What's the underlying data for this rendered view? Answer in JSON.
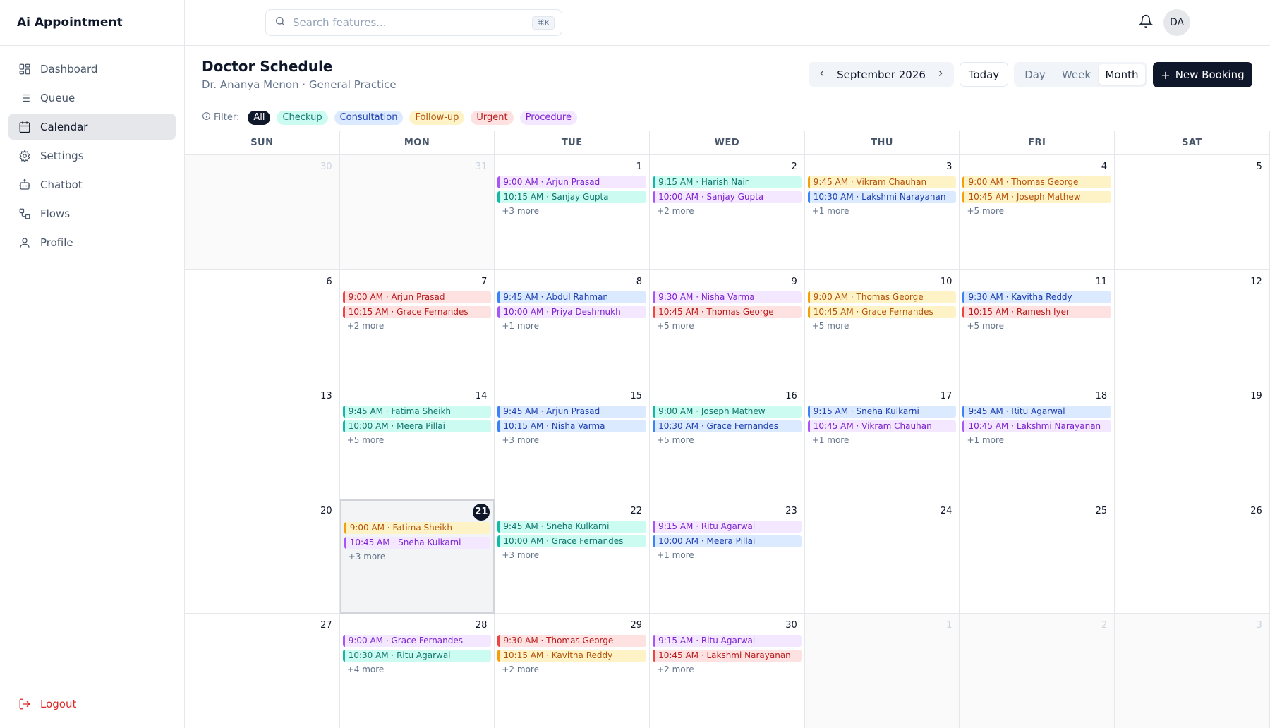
{
  "app": {
    "title": "Ai Appointment"
  },
  "sidebar": {
    "items": [
      {
        "label": "Dashboard",
        "icon": "dashboard-icon",
        "active": false
      },
      {
        "label": "Queue",
        "icon": "list-icon",
        "active": false
      },
      {
        "label": "Calendar",
        "icon": "calendar-icon",
        "active": true
      },
      {
        "label": "Settings",
        "icon": "gear-icon",
        "active": false
      },
      {
        "label": "Chatbot",
        "icon": "bot-icon",
        "active": false
      },
      {
        "label": "Flows",
        "icon": "flow-icon",
        "active": false
      },
      {
        "label": "Profile",
        "icon": "user-icon",
        "active": false
      }
    ],
    "logout": "Logout"
  },
  "topbar": {
    "search_placeholder": "Search features...",
    "shortcut": "⌘K",
    "avatar": "DA"
  },
  "header": {
    "title": "Doctor Schedule",
    "subtitle": "Dr. Ananya Menon · General Practice",
    "month": "September 2026",
    "today": "Today",
    "views": [
      "Day",
      "Week",
      "Month"
    ],
    "active_view": "Month",
    "new_booking": "New Booking"
  },
  "filter": {
    "label": "Filter:",
    "chips": [
      {
        "label": "All",
        "key": "all"
      },
      {
        "label": "Checkup",
        "key": "checkup"
      },
      {
        "label": "Consultation",
        "key": "consultation"
      },
      {
        "label": "Follow-up",
        "key": "followup"
      },
      {
        "label": "Urgent",
        "key": "urgent"
      },
      {
        "label": "Procedure",
        "key": "procedure"
      }
    ]
  },
  "colors": {
    "all": {
      "bg": "#0f172a",
      "fg": "#ffffff",
      "border": "#0f172a"
    },
    "checkup": {
      "bg": "#ccfbf1",
      "fg": "#0f766e",
      "border": "#14b8a6"
    },
    "consultation": {
      "bg": "#dbeafe",
      "fg": "#1e40af",
      "border": "#3b82f6"
    },
    "followup": {
      "bg": "#fef3c7",
      "fg": "#b45309",
      "border": "#f59e0b"
    },
    "urgent": {
      "bg": "#fee2e2",
      "fg": "#b91c1c",
      "border": "#ef4444"
    },
    "procedure": {
      "bg": "#f3e8ff",
      "fg": "#7e22ce",
      "border": "#a855f7"
    }
  },
  "calendar": {
    "weekdays": [
      "SUN",
      "MON",
      "TUE",
      "WED",
      "THU",
      "FRI",
      "SAT"
    ],
    "selected_date": "21",
    "weeks": [
      [
        {
          "date": "30",
          "other": true,
          "events": []
        },
        {
          "date": "31",
          "other": true,
          "events": []
        },
        {
          "date": "1",
          "events": [
            {
              "time": "9:00 AM",
              "name": "Arjun Prasad",
              "type": "procedure"
            },
            {
              "time": "10:15 AM",
              "name": "Sanjay Gupta",
              "type": "checkup"
            }
          ],
          "more": "+3 more"
        },
        {
          "date": "2",
          "events": [
            {
              "time": "9:15 AM",
              "name": "Harish Nair",
              "type": "checkup"
            },
            {
              "time": "10:00 AM",
              "name": "Sanjay Gupta",
              "type": "procedure"
            }
          ],
          "more": "+2 more"
        },
        {
          "date": "3",
          "events": [
            {
              "time": "9:45 AM",
              "name": "Vikram Chauhan",
              "type": "followup"
            },
            {
              "time": "10:30 AM",
              "name": "Lakshmi Narayanan",
              "type": "consultation"
            }
          ],
          "more": "+1 more"
        },
        {
          "date": "4",
          "events": [
            {
              "time": "9:00 AM",
              "name": "Thomas George",
              "type": "followup"
            },
            {
              "time": "10:45 AM",
              "name": "Joseph Mathew",
              "type": "followup"
            }
          ],
          "more": "+5 more"
        },
        {
          "date": "5",
          "events": []
        }
      ],
      [
        {
          "date": "6",
          "events": []
        },
        {
          "date": "7",
          "events": [
            {
              "time": "9:00 AM",
              "name": "Arjun Prasad",
              "type": "urgent"
            },
            {
              "time": "10:15 AM",
              "name": "Grace Fernandes",
              "type": "urgent"
            }
          ],
          "more": "+2 more"
        },
        {
          "date": "8",
          "events": [
            {
              "time": "9:45 AM",
              "name": "Abdul Rahman",
              "type": "consultation"
            },
            {
              "time": "10:00 AM",
              "name": "Priya Deshmukh",
              "type": "procedure"
            }
          ],
          "more": "+1 more"
        },
        {
          "date": "9",
          "events": [
            {
              "time": "9:30 AM",
              "name": "Nisha Varma",
              "type": "procedure"
            },
            {
              "time": "10:45 AM",
              "name": "Thomas George",
              "type": "urgent"
            }
          ],
          "more": "+5 more"
        },
        {
          "date": "10",
          "events": [
            {
              "time": "9:00 AM",
              "name": "Thomas George",
              "type": "followup"
            },
            {
              "time": "10:45 AM",
              "name": "Grace Fernandes",
              "type": "followup"
            }
          ],
          "more": "+5 more"
        },
        {
          "date": "11",
          "events": [
            {
              "time": "9:30 AM",
              "name": "Kavitha Reddy",
              "type": "consultation"
            },
            {
              "time": "10:15 AM",
              "name": "Ramesh Iyer",
              "type": "urgent"
            }
          ],
          "more": "+5 more"
        },
        {
          "date": "12",
          "events": []
        }
      ],
      [
        {
          "date": "13",
          "events": []
        },
        {
          "date": "14",
          "events": [
            {
              "time": "9:45 AM",
              "name": "Fatima Sheikh",
              "type": "checkup"
            },
            {
              "time": "10:00 AM",
              "name": "Meera Pillai",
              "type": "checkup"
            }
          ],
          "more": "+5 more"
        },
        {
          "date": "15",
          "events": [
            {
              "time": "9:45 AM",
              "name": "Arjun Prasad",
              "type": "consultation"
            },
            {
              "time": "10:15 AM",
              "name": "Nisha Varma",
              "type": "consultation"
            }
          ],
          "more": "+3 more"
        },
        {
          "date": "16",
          "events": [
            {
              "time": "9:00 AM",
              "name": "Joseph Mathew",
              "type": "checkup"
            },
            {
              "time": "10:30 AM",
              "name": "Grace Fernandes",
              "type": "consultation"
            }
          ],
          "more": "+5 more"
        },
        {
          "date": "17",
          "events": [
            {
              "time": "9:15 AM",
              "name": "Sneha Kulkarni",
              "type": "consultation"
            },
            {
              "time": "10:45 AM",
              "name": "Vikram Chauhan",
              "type": "procedure"
            }
          ],
          "more": "+1 more"
        },
        {
          "date": "18",
          "events": [
            {
              "time": "9:45 AM",
              "name": "Ritu Agarwal",
              "type": "consultation"
            },
            {
              "time": "10:45 AM",
              "name": "Lakshmi Narayanan",
              "type": "procedure"
            }
          ],
          "more": "+1 more"
        },
        {
          "date": "19",
          "events": []
        }
      ],
      [
        {
          "date": "20",
          "events": []
        },
        {
          "date": "21",
          "events": [
            {
              "time": "9:00 AM",
              "name": "Fatima Sheikh",
              "type": "followup"
            },
            {
              "time": "10:45 AM",
              "name": "Sneha Kulkarni",
              "type": "procedure"
            }
          ],
          "more": "+3 more"
        },
        {
          "date": "22",
          "events": [
            {
              "time": "9:45 AM",
              "name": "Sneha Kulkarni",
              "type": "checkup"
            },
            {
              "time": "10:00 AM",
              "name": "Grace Fernandes",
              "type": "checkup"
            }
          ],
          "more": "+3 more"
        },
        {
          "date": "23",
          "events": [
            {
              "time": "9:15 AM",
              "name": "Ritu Agarwal",
              "type": "procedure"
            },
            {
              "time": "10:00 AM",
              "name": "Meera Pillai",
              "type": "consultation"
            }
          ],
          "more": "+1 more"
        },
        {
          "date": "24",
          "events": []
        },
        {
          "date": "25",
          "events": []
        },
        {
          "date": "26",
          "events": []
        }
      ],
      [
        {
          "date": "27",
          "events": []
        },
        {
          "date": "28",
          "events": [
            {
              "time": "9:00 AM",
              "name": "Grace Fernandes",
              "type": "procedure"
            },
            {
              "time": "10:30 AM",
              "name": "Ritu Agarwal",
              "type": "checkup"
            }
          ],
          "more": "+4 more"
        },
        {
          "date": "29",
          "events": [
            {
              "time": "9:30 AM",
              "name": "Thomas George",
              "type": "urgent"
            },
            {
              "time": "10:15 AM",
              "name": "Kavitha Reddy",
              "type": "followup"
            }
          ],
          "more": "+2 more"
        },
        {
          "date": "30",
          "events": [
            {
              "time": "9:15 AM",
              "name": "Ritu Agarwal",
              "type": "procedure"
            },
            {
              "time": "10:45 AM",
              "name": "Lakshmi Narayanan",
              "type": "urgent"
            }
          ],
          "more": "+2 more"
        },
        {
          "date": "1",
          "other": true,
          "events": []
        },
        {
          "date": "2",
          "other": true,
          "events": []
        },
        {
          "date": "3",
          "other": true,
          "events": []
        }
      ]
    ]
  }
}
